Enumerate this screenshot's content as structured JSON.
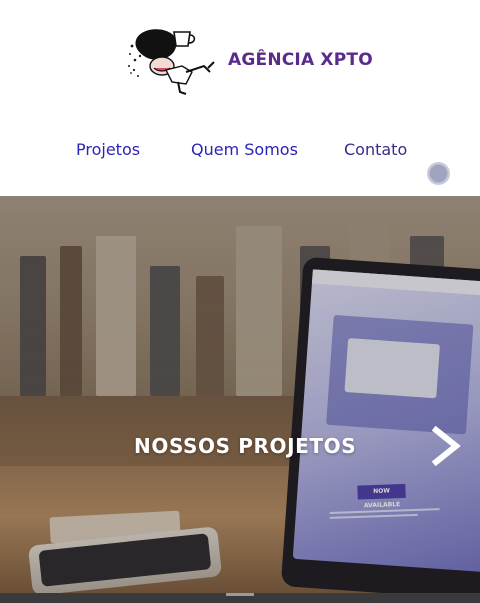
{
  "header": {
    "brand": "AGÊNCIA XPTO",
    "logo_icon": "character-with-cup-logo-icon"
  },
  "nav": {
    "items": [
      {
        "label": "Projetos"
      },
      {
        "label": "Quem Somos"
      },
      {
        "label": "Contato"
      }
    ],
    "toggle_icon": "theme-toggle-icon"
  },
  "hero": {
    "title": "NOSSOS PROJETOS",
    "next_icon": "chevron-right-icon",
    "screen_badge": "NOW AVAILABLE"
  },
  "colors": {
    "brand": "#5a2b8c",
    "nav_link": "#2a24b8",
    "hero_text": "#ffffff"
  }
}
